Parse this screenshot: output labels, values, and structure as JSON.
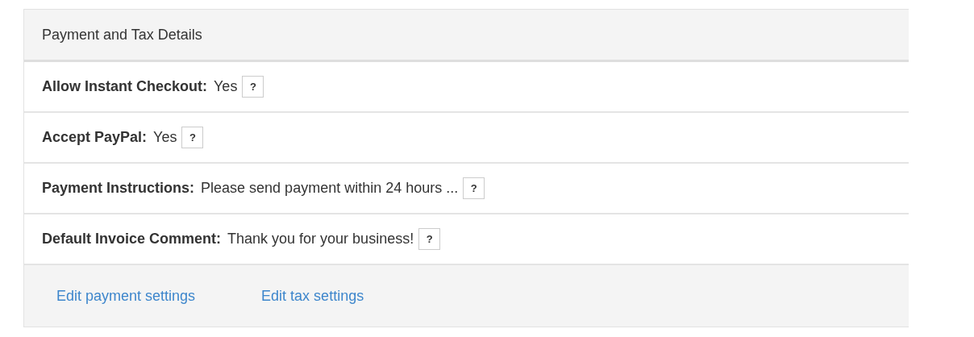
{
  "panel": {
    "title": "Payment and Tax Details"
  },
  "settings": [
    {
      "label": "Allow Instant Checkout:",
      "value": "Yes",
      "help": "?"
    },
    {
      "label": "Accept PayPal:",
      "value": "Yes",
      "help": "?"
    },
    {
      "label": "Payment Instructions:",
      "value": "Please send payment within 24 hours ...",
      "help": "?"
    },
    {
      "label": "Default Invoice Comment:",
      "value": "Thank you for your business!",
      "help": "?"
    }
  ],
  "links": [
    "Edit payment settings",
    "Edit tax settings"
  ]
}
